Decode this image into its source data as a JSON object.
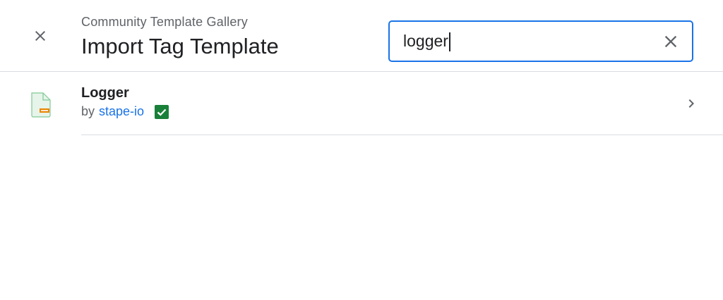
{
  "header": {
    "subtitle": "Community Template Gallery",
    "title": "Import Tag Template"
  },
  "search": {
    "value": "logger",
    "placeholder": ""
  },
  "results": [
    {
      "name": "Logger",
      "by_label": "by",
      "author": "stape-io",
      "verified": true
    }
  ],
  "colors": {
    "accent": "#1a73e8",
    "verified": "#188038",
    "file_icon_body": "#e6f4ea",
    "file_icon_border": "#81c995",
    "file_icon_tag": "#ea8600"
  }
}
